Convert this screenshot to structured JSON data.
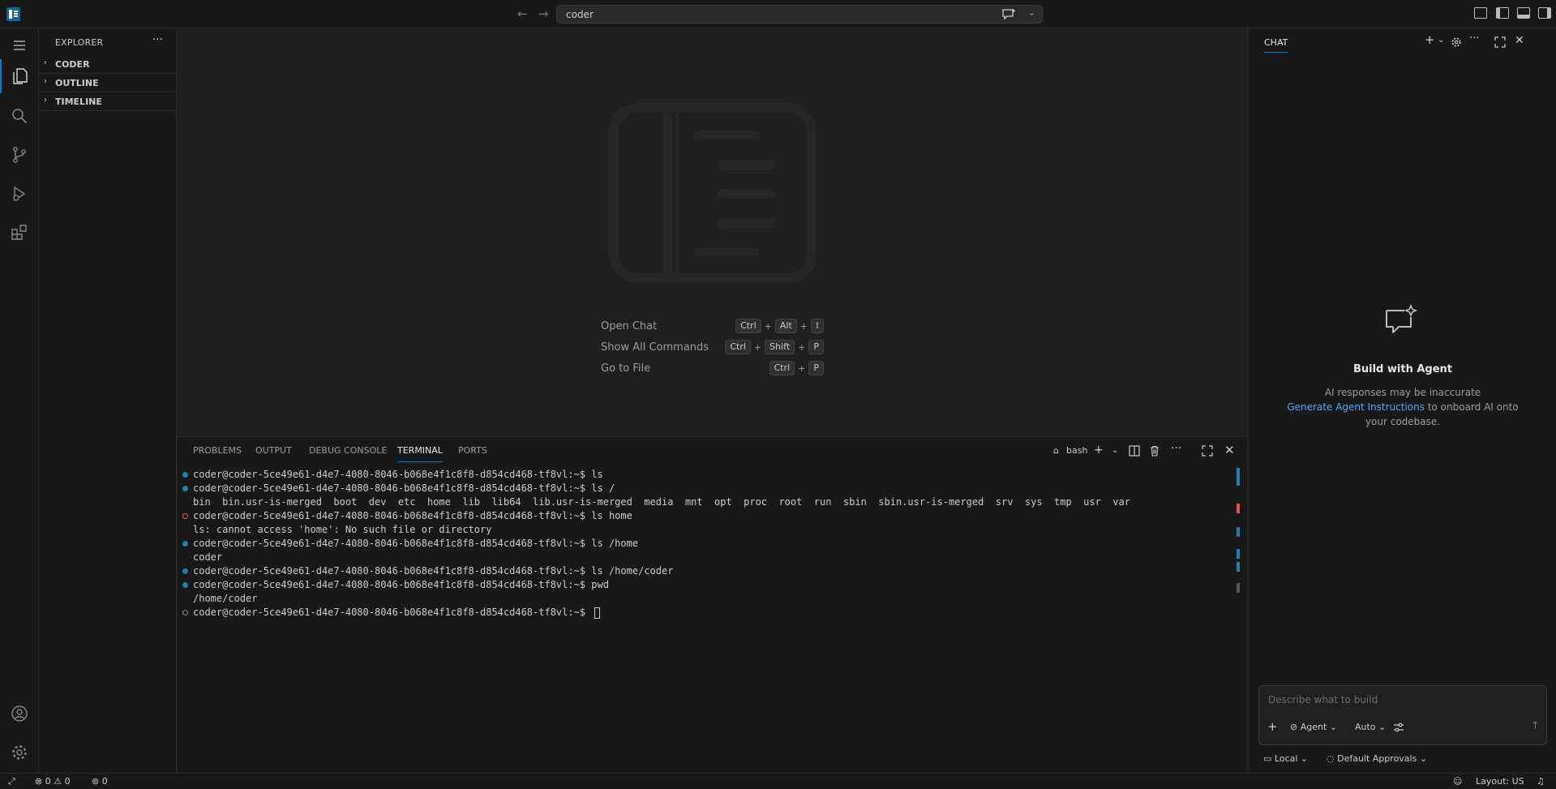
{
  "titlebar": {
    "search_text": "coder",
    "back_arrow": "←",
    "forward_arrow": "→"
  },
  "sidebar": {
    "title": "EXPLORER",
    "more": "···",
    "sections": [
      {
        "label": "CODER"
      },
      {
        "label": "OUTLINE"
      },
      {
        "label": "TIMELINE"
      }
    ]
  },
  "editor": {
    "shortcuts": [
      {
        "name": "Open Chat",
        "keys": [
          "Ctrl",
          "Alt",
          "I"
        ]
      },
      {
        "name": "Show All Commands",
        "keys": [
          "Ctrl",
          "Shift",
          "P"
        ]
      },
      {
        "name": "Go to File",
        "keys": [
          "Ctrl",
          "P"
        ]
      }
    ]
  },
  "panel": {
    "tabs": [
      "PROBLEMS",
      "OUTPUT",
      "DEBUG CONSOLE",
      "TERMINAL",
      "PORTS"
    ],
    "active_tab": "TERMINAL",
    "shell": "bash",
    "lines": [
      {
        "status": "ok",
        "text": "coder@coder-5ce49e61-d4e7-4080-8046-b068e4f1c8f8-d854cd468-tf8vl:~$ ls"
      },
      {
        "status": "ok",
        "text": "coder@coder-5ce49e61-d4e7-4080-8046-b068e4f1c8f8-d854cd468-tf8vl:~$ ls /"
      },
      {
        "status": "none",
        "text": "bin  bin.usr-is-merged  boot  dev  etc  home  lib  lib64  lib.usr-is-merged  media  mnt  opt  proc  root  run  sbin  sbin.usr-is-merged  srv  sys  tmp  usr  var"
      },
      {
        "status": "err",
        "text": "coder@coder-5ce49e61-d4e7-4080-8046-b068e4f1c8f8-d854cd468-tf8vl:~$ ls home"
      },
      {
        "status": "none",
        "text": "ls: cannot access 'home': No such file or directory"
      },
      {
        "status": "ok",
        "text": "coder@coder-5ce49e61-d4e7-4080-8046-b068e4f1c8f8-d854cd468-tf8vl:~$ ls /home"
      },
      {
        "status": "none",
        "text": "coder"
      },
      {
        "status": "ok",
        "text": "coder@coder-5ce49e61-d4e7-4080-8046-b068e4f1c8f8-d854cd468-tf8vl:~$ ls /home/coder"
      },
      {
        "status": "ok",
        "text": "coder@coder-5ce49e61-d4e7-4080-8046-b068e4f1c8f8-d854cd468-tf8vl:~$ pwd"
      },
      {
        "status": "none",
        "text": "/home/coder"
      },
      {
        "status": "empty",
        "text": "coder@coder-5ce49e61-d4e7-4080-8046-b068e4f1c8f8-d854cd468-tf8vl:~$ "
      }
    ]
  },
  "chat": {
    "title": "CHAT",
    "heading": "Build with Agent",
    "disclaimer": "AI responses may be inaccurate",
    "link": "Generate Agent Instructions",
    "link_suffix": " to onboard AI onto your codebase.",
    "placeholder": "Describe what to build",
    "mode": "Agent",
    "model": "Auto",
    "location": "Local",
    "approvals": "Default Approvals"
  },
  "statusbar": {
    "errors": "0",
    "warnings": "0",
    "ports": "0",
    "layout": "Layout: US"
  },
  "colors": {
    "accent": "#0078d4",
    "ok_dot": "#1b80b2",
    "err_dot": "#f14c4c",
    "link": "#4daafc"
  }
}
